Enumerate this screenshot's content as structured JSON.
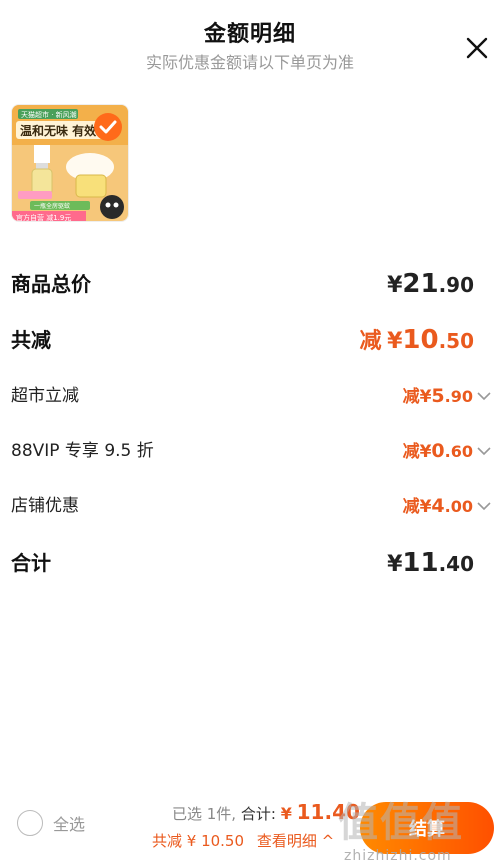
{
  "header": {
    "title": "金额明细",
    "subtitle": "实际优惠金额请以下单页为准"
  },
  "product": {
    "image_banner_text": "温和无味 有效",
    "image_top_tag": "天猫超市 · 新风潮",
    "image_bottom_tag": "官方自营 减1.9元",
    "image_ribbon": "一瓶全房驱蚊"
  },
  "rows": {
    "total_price": {
      "label": "商品总价",
      "currency": "¥",
      "int": "21",
      "dec": ".90"
    },
    "total_discount": {
      "label": "共减",
      "prefix": "减",
      "currency": "¥",
      "int": "10",
      "dec": ".50"
    },
    "supermarket": {
      "label": "超市立减",
      "prefix": "减",
      "currency": "¥",
      "int": "5",
      "dec": ".90"
    },
    "vip": {
      "label": "88VIP 专享 9.5 折",
      "prefix": "减",
      "currency": "¥",
      "int": "0",
      "dec": ".60"
    },
    "store": {
      "label": "店铺优惠",
      "prefix": "减",
      "currency": "¥",
      "int": "4",
      "dec": ".00"
    },
    "subtotal": {
      "label": "合计",
      "currency": "¥",
      "int": "11",
      "dec": ".40"
    }
  },
  "bottom_bar": {
    "select_all": "全选",
    "selected_text": "已选 1件,",
    "total_label": "合计:",
    "total_currency": "¥",
    "total_value": "11.40",
    "discount_text": "共减 ¥ 10.50",
    "view_detail": "查看明细 ^",
    "checkout": "结算"
  },
  "watermark": {
    "text": "值值值",
    "url": "zhizhizhi.com"
  },
  "colors": {
    "accent": "#ea5a1e",
    "text": "#111111",
    "muted": "#999999"
  }
}
